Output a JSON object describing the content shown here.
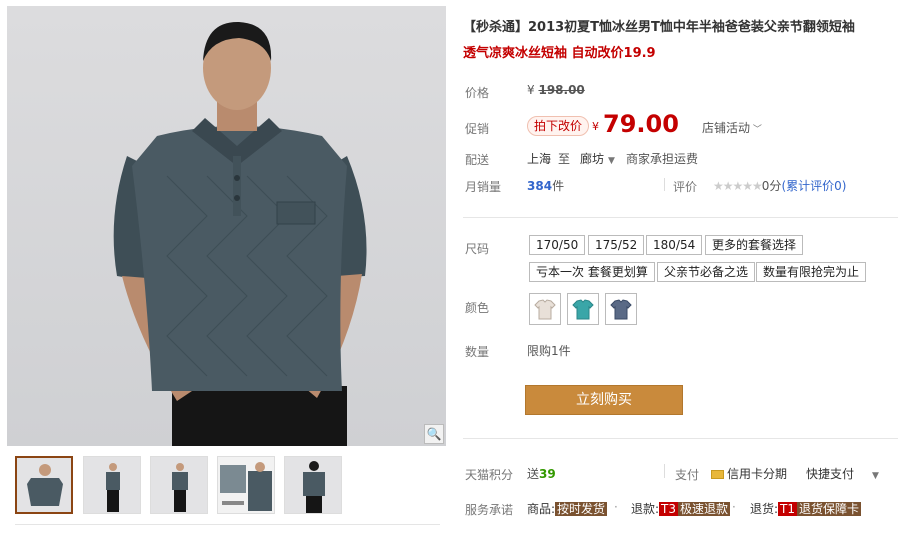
{
  "product": {
    "title": "【秒杀通】2013初夏T恤冰丝男T恤中年半袖爸爸装父亲节翻领短袖",
    "subtitle": "透气凉爽冰丝短袖 自动改价19.9"
  },
  "price": {
    "label": "价格",
    "currency": "¥",
    "original": "198.00",
    "promo_label": "促销",
    "promo_badge": "拍下改价",
    "promo_currency": "¥",
    "promo_value": "79.00",
    "store_activity": "店铺活动"
  },
  "shipping": {
    "label": "配送",
    "from": "上海",
    "to_word": "至",
    "dest": "廊坊",
    "note": "商家承担运费"
  },
  "sales": {
    "label": "月销量",
    "count": "384",
    "unit": "件",
    "rating_label": "评价",
    "stars": "★★★★★",
    "rating_value": "0分",
    "review_link": "(累计评价0)"
  },
  "size": {
    "label": "尺码",
    "options": [
      "170/50",
      "175/52",
      "180/54",
      "更多的套餐选择",
      "亏本一次 套餐更划算",
      "父亲节必备之选",
      "数量有限抢完为止"
    ]
  },
  "color": {
    "label": "颜色",
    "swatches": [
      {
        "name": "beige-shirt-swatch",
        "color": "#e8e0d8"
      },
      {
        "name": "teal-shirt-swatch",
        "color": "#3aa6a8"
      },
      {
        "name": "navy-shirt-swatch",
        "color": "#5a6a86"
      }
    ]
  },
  "quantity": {
    "label": "数量",
    "limit": "限购1件"
  },
  "buy_button": "立刻购买",
  "points": {
    "label": "天猫积分",
    "give": "送",
    "value": "39",
    "pay_label": "支付",
    "credit_card": "信用卡分期",
    "quick_pay": "快捷支付"
  },
  "service": {
    "label": "服务承诺",
    "goods_label": "商品:",
    "goods_tag": "按时发货",
    "refund_label": "退款:",
    "refund_code": "T3",
    "refund_tag": "极速退款",
    "return_label": "退货:",
    "return_code": "T1",
    "return_tag": "退货保障卡"
  },
  "colors": {
    "accent": "#c40000",
    "buy": "#c98a3c",
    "shirt": "#4a5a63"
  }
}
